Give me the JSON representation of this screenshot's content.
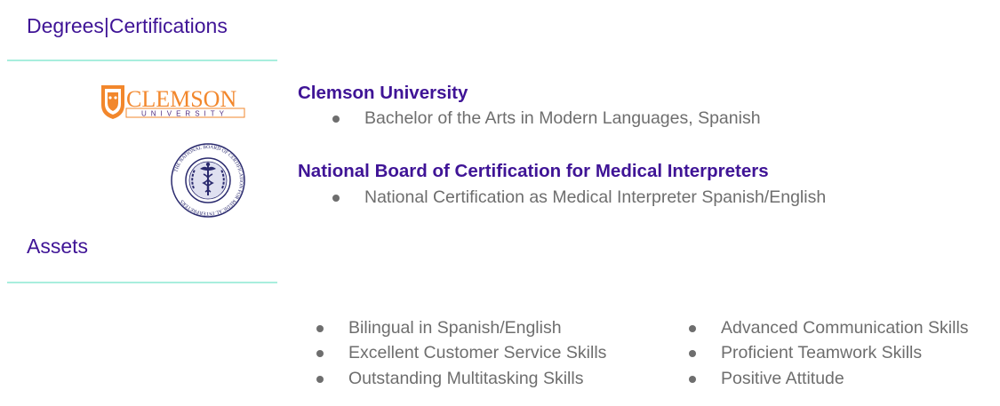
{
  "sections": {
    "degrees": {
      "heading": "Degrees|Certifications",
      "entries": [
        {
          "institution": "Clemson University",
          "logo": "clemson-logo",
          "logo_text": "CLEMSON",
          "logo_subtext": "UNIVERSITY",
          "items": [
            "Bachelor of the Arts in Modern Languages, Spanish"
          ]
        },
        {
          "institution": "National Board of Certification for Medical Interpreters",
          "logo": "national-board-seal",
          "logo_text": "THE NATIONAL BOARD OF CERTIFICATION FOR MEDICAL INTERPRETERS",
          "items": [
            "National Certification as Medical Interpreter Spanish/English"
          ]
        }
      ]
    },
    "assets": {
      "heading": "Assets",
      "left_items": [
        "Bilingual in Spanish/English",
        "Excellent Customer Service Skills",
        "Outstanding Multitasking Skills"
      ],
      "right_items": [
        "Advanced Communication Skills",
        "Proficient Teamwork Skills",
        "Positive Attitude"
      ]
    }
  },
  "colors": {
    "heading": "#3f1496",
    "rule": "#a8eedd",
    "body_text": "#6e6e6e",
    "clemson_orange": "#f2872c",
    "clemson_purple": "#522d80",
    "seal_navy": "#2a2a6e"
  }
}
